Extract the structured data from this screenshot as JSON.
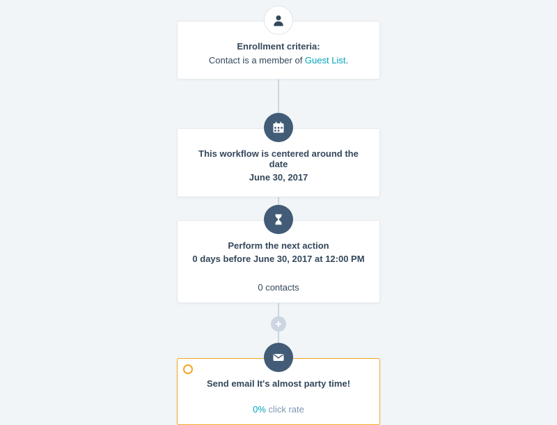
{
  "colors": {
    "accent": "#00a4bd",
    "warn": "#f5a623",
    "navy": "#425b76",
    "text": "#33475b"
  },
  "enrollment": {
    "title": "Enrollment criteria:",
    "prefix": "Contact is a member of ",
    "list_name": "Guest List",
    "suffix": "."
  },
  "center_date": {
    "line1": "This workflow is centered around the date",
    "line2": "June 30, 2017"
  },
  "delay": {
    "line1": "Perform the next action",
    "line2": "0 days before June 30, 2017 at 12:00 PM",
    "contacts": "0 contacts"
  },
  "email": {
    "label": "Send email ",
    "name": "It's almost party time!",
    "rate_value": "0%",
    "rate_label": " click rate"
  },
  "icons": {
    "user": "user-icon",
    "calendar": "calendar-icon",
    "hourglass": "hourglass-icon",
    "plus": "plus-icon",
    "mail": "mail-icon"
  }
}
